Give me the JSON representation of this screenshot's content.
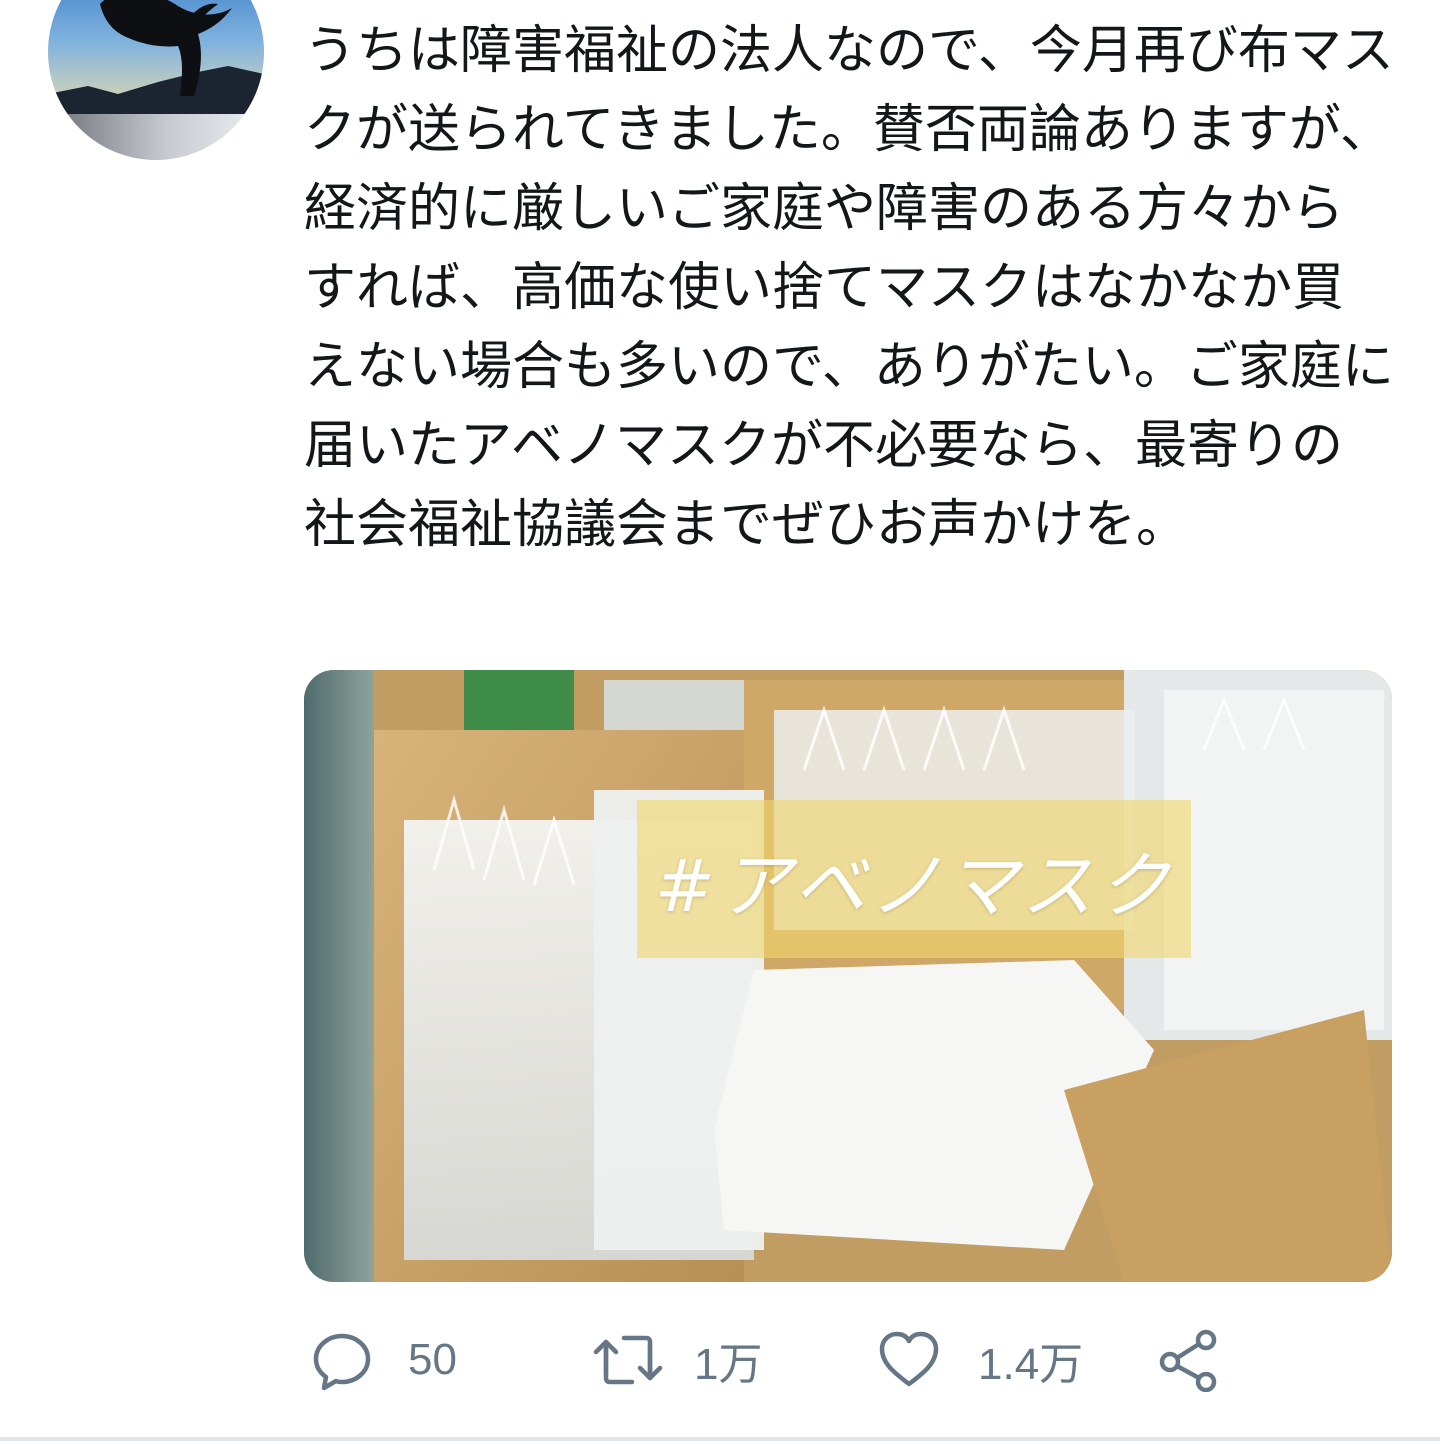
{
  "tweet": {
    "text": "うちは障害福祉の法人なので、今月再び布マスクが送られてきました。賛否両論ありますが、経済的に厳しいご家庭や障害のある方々からすれば、高価な使い捨てマスクはなかなか買えない場合も多いので、ありがたい。ご家庭に届いたアベノマスクが不必要なら、最寄りの社会福祉協議会までぜひお声かけを。"
  },
  "media": {
    "overlay_text": "#アベノマスク"
  },
  "actions": {
    "reply_count": "50",
    "retweet_count": "1万",
    "like_count": "1.4万"
  },
  "icons": {
    "reply": "reply-icon",
    "retweet": "retweet-icon",
    "like": "heart-icon",
    "share": "share-icon"
  },
  "colors": {
    "text": "#14171a",
    "secondary": "#657786",
    "divider": "#e1e8ed"
  }
}
